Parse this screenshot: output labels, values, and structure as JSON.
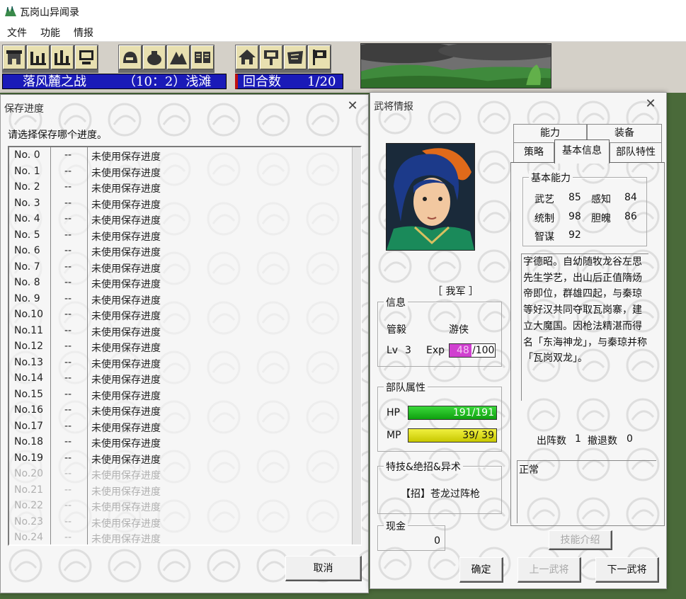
{
  "window": {
    "title": "瓦岗山异闻录"
  },
  "menu": [
    "文件",
    "功能",
    "情报"
  ],
  "status": {
    "battle_name": "落风麓之战",
    "position": "（10：2）浅滩",
    "turn_label": "回合数",
    "turn_value": "1/20"
  },
  "save_dialog": {
    "title": "保存进度",
    "prompt": "请选择保存哪个进度。",
    "rows": [
      {
        "no": "No. 0",
        "date": "--",
        "desc": "未使用保存进度"
      },
      {
        "no": "No. 1",
        "date": "--",
        "desc": "未使用保存进度"
      },
      {
        "no": "No. 2",
        "date": "--",
        "desc": "未使用保存进度"
      },
      {
        "no": "No. 3",
        "date": "--",
        "desc": "未使用保存进度"
      },
      {
        "no": "No. 4",
        "date": "--",
        "desc": "未使用保存进度"
      },
      {
        "no": "No. 5",
        "date": "--",
        "desc": "未使用保存进度"
      },
      {
        "no": "No. 6",
        "date": "--",
        "desc": "未使用保存进度"
      },
      {
        "no": "No. 7",
        "date": "--",
        "desc": "未使用保存进度"
      },
      {
        "no": "No. 8",
        "date": "--",
        "desc": "未使用保存进度"
      },
      {
        "no": "No. 9",
        "date": "--",
        "desc": "未使用保存进度"
      },
      {
        "no": "No.10",
        "date": "--",
        "desc": "未使用保存进度"
      },
      {
        "no": "No.11",
        "date": "--",
        "desc": "未使用保存进度"
      },
      {
        "no": "No.12",
        "date": "--",
        "desc": "未使用保存进度"
      },
      {
        "no": "No.13",
        "date": "--",
        "desc": "未使用保存进度"
      },
      {
        "no": "No.14",
        "date": "--",
        "desc": "未使用保存进度"
      },
      {
        "no": "No.15",
        "date": "--",
        "desc": "未使用保存进度"
      },
      {
        "no": "No.16",
        "date": "--",
        "desc": "未使用保存进度"
      },
      {
        "no": "No.17",
        "date": "--",
        "desc": "未使用保存进度"
      },
      {
        "no": "No.18",
        "date": "--",
        "desc": "未使用保存进度"
      },
      {
        "no": "No.19",
        "date": "--",
        "desc": "未使用保存进度"
      },
      {
        "no": "No.20",
        "date": "--",
        "desc": "未使用保存进度",
        "disabled": true
      },
      {
        "no": "No.21",
        "date": "--",
        "desc": "未使用保存进度",
        "disabled": true
      },
      {
        "no": "No.22",
        "date": "--",
        "desc": "未使用保存进度",
        "disabled": true
      },
      {
        "no": "No.23",
        "date": "--",
        "desc": "未使用保存进度",
        "disabled": true
      },
      {
        "no": "No.24",
        "date": "--",
        "desc": "未使用保存进度",
        "disabled": true
      }
    ],
    "cancel_label": "取消"
  },
  "general_dialog": {
    "title": "武将情报",
    "faction": "［ 我军 ］",
    "info_label": "信息",
    "name": "管毅",
    "class": "游侠",
    "lv_label": "Lv",
    "lv": "3",
    "exp_label": "Exp",
    "exp_current": "48",
    "exp_max": "/100",
    "exp_fraction": 0.48,
    "unit_label": "部队属性",
    "hp_label": "HP",
    "hp_text": "191/191",
    "hp_fraction": 1.0,
    "mp_label": "MP",
    "mp_text": "39/ 39",
    "mp_fraction": 1.0,
    "skills_label": "特技&绝招&异术",
    "skill": "【招】苍龙过阵枪",
    "money_label": "现金",
    "money": "0",
    "tabs_top": [
      "能力",
      "装备"
    ],
    "tabs_bottom": [
      "策略",
      "基本信息",
      "部队特性"
    ],
    "basic_label": "基本能力",
    "stats": [
      {
        "k": "武艺",
        "v": "85"
      },
      {
        "k": "感知",
        "v": "84"
      },
      {
        "k": "统制",
        "v": "98"
      },
      {
        "k": "胆魄",
        "v": "86"
      },
      {
        "k": "智谋",
        "v": "92"
      }
    ],
    "bio": "字德昭。自幼随牧龙谷左思先生学艺，出山后正值隋炀帝即位，群雄四起，与秦琼等好汉共同夺取瓦岗寨，建立大魔国。因枪法精湛而得名「东海神龙」，与秦琼并称「瓦岗双龙」。",
    "sortie_label": "出阵数",
    "sortie": "1",
    "retreat_label": "撤退数",
    "retreat": "0",
    "condition": "正常",
    "skill_intro_label": "技能介绍",
    "ok_label": "确定",
    "prev_label": "上一武将",
    "next_label": "下一武将"
  },
  "colors": {
    "status_bg": "#1a1ab8",
    "hp": "#16b816",
    "mp": "#e0e000",
    "exp": "#d040d0"
  }
}
